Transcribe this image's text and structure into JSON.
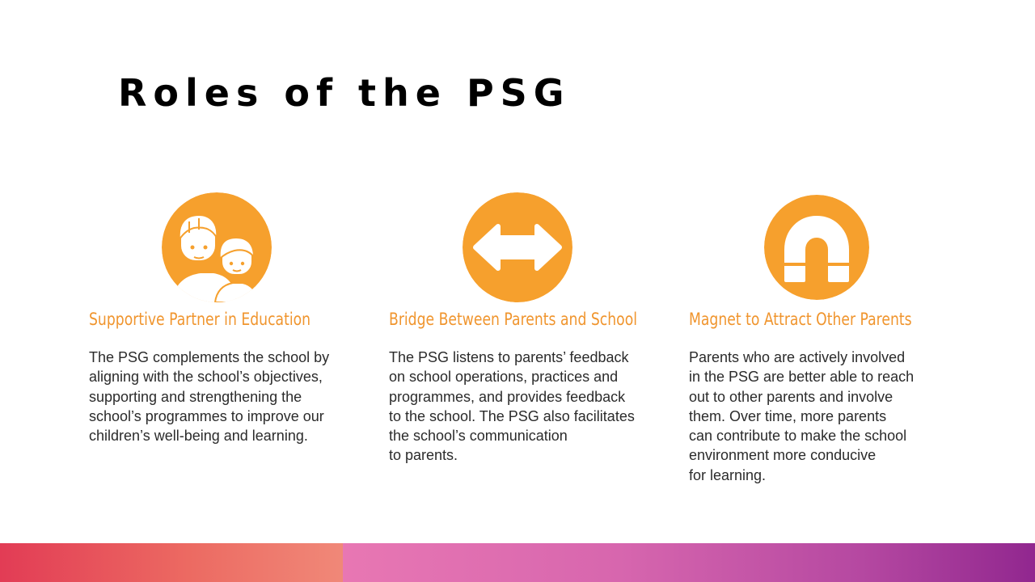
{
  "slide": {
    "title": "Roles of the PSG"
  },
  "roles": [
    {
      "icon": "parent-and-child-icon",
      "heading": "Supportive Partner in Education",
      "body_lines": [
        "The PSG complements the school by",
        "aligning with the school’s objectives,",
        "supporting and strengthening the",
        "school’s programmes to improve our",
        "children’s well-being and learning."
      ]
    },
    {
      "icon": "double-arrow-icon",
      "heading": "Bridge Between Parents and School",
      "body_lines": [
        "The PSG listens to parents’ feedback",
        "on school operations, practices and",
        "programmes, and provides feedback",
        "to the school. The PSG also facilitates",
        "the school’s communication",
        "to parents."
      ]
    },
    {
      "icon": "magnet-icon",
      "heading": "Magnet to Attract Other Parents",
      "body_lines": [
        "Parents who are actively involved",
        "in the PSG are better able to reach",
        "out to other parents and involve",
        "them. Over time, more parents",
        "can contribute to make the school",
        "environment more conducive",
        "for learning."
      ]
    }
  ],
  "colors": {
    "accent_orange": "#f6a02d",
    "heading_orange": "#f0952e",
    "body_text": "#2b2b2b",
    "bar_left_start": "#e23c55",
    "bar_right_end": "#91278f"
  }
}
